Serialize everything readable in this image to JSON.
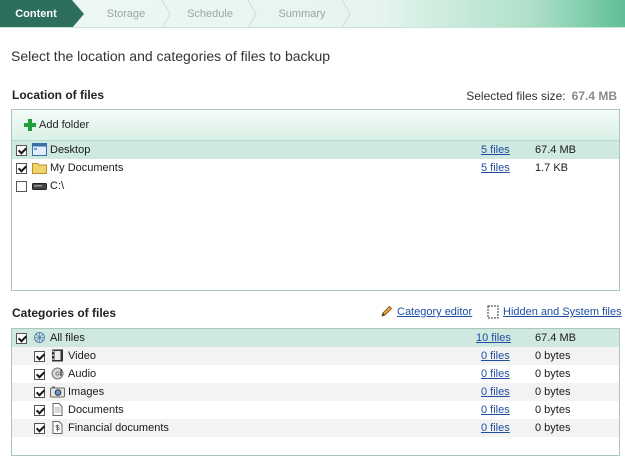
{
  "wizard": {
    "steps": [
      {
        "label": "Content"
      },
      {
        "label": "Storage"
      },
      {
        "label": "Schedule"
      },
      {
        "label": "Summary"
      }
    ]
  },
  "page": {
    "heading": "Select the location and categories of files to backup"
  },
  "location": {
    "title": "Location of files",
    "selected_size_label": "Selected files size:",
    "selected_size_value": "67.4 MB",
    "add_folder": "Add folder",
    "rows": [
      {
        "name": "Desktop",
        "files": "5 files",
        "size": "67.4 MB",
        "checked": true
      },
      {
        "name": "My Documents",
        "files": "5 files",
        "size": "1.7 KB",
        "checked": true
      },
      {
        "name": "C:\\",
        "files": "",
        "size": "",
        "checked": false
      }
    ]
  },
  "categories": {
    "title": "Categories of files",
    "category_editor": "Category editor",
    "hidden_system": "Hidden and System files",
    "rows": [
      {
        "name": "All files",
        "files": "10 files",
        "size": "67.4 MB",
        "checked": true
      },
      {
        "name": "Video",
        "files": "0 files",
        "size": "0 bytes",
        "checked": true
      },
      {
        "name": "Audio",
        "files": "0 files",
        "size": "0 bytes",
        "checked": true
      },
      {
        "name": "Images",
        "files": "0 files",
        "size": "0 bytes",
        "checked": true
      },
      {
        "name": "Documents",
        "files": "0 files",
        "size": "0 bytes",
        "checked": true
      },
      {
        "name": "Financial documents",
        "files": "0 files",
        "size": "0 bytes",
        "checked": true
      }
    ]
  },
  "colors": {
    "accent": "#2e6e5c",
    "link": "#1f4ea0",
    "selection": "#cfe8e0"
  }
}
